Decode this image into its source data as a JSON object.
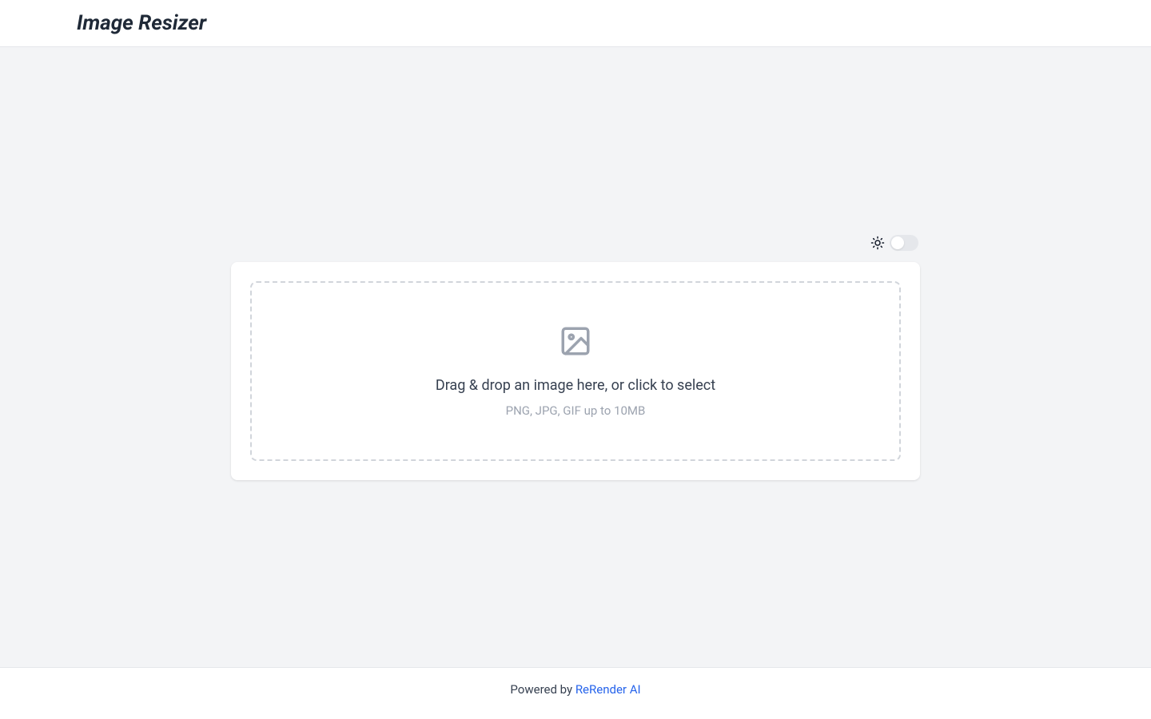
{
  "header": {
    "title": "Image Resizer"
  },
  "theme_toggle": {
    "icon": "sun-icon",
    "state": "light"
  },
  "dropzone": {
    "primary_text": "Drag & drop an image here, or click to select",
    "secondary_text": "PNG, JPG, GIF up to 10MB"
  },
  "footer": {
    "prefix": "Powered by ",
    "link_text": "ReRender AI"
  }
}
